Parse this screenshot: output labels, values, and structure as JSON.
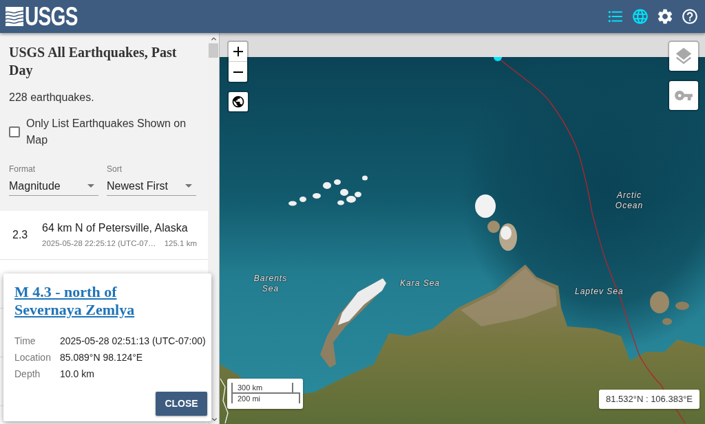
{
  "header": {
    "logo_text": "USGS",
    "nav_buttons": [
      {
        "kind": "list",
        "on": true
      },
      {
        "kind": "map",
        "on": true
      },
      {
        "kind": "settings",
        "on": false
      },
      {
        "kind": "help",
        "on": false
      }
    ]
  },
  "sidebar": {
    "title": "USGS All Earthquakes, Past Day",
    "count": "228 earthquakes.",
    "filter_checkbox": {
      "label": "Only List Earthquakes Shown on Map",
      "checked": false
    },
    "selects": [
      {
        "label": "Format",
        "value": "Magnitude"
      },
      {
        "label": "Sort",
        "value": "Newest First"
      }
    ],
    "earthquakes": [
      {
        "magnitude": "2.3",
        "place": "64 km N of Petersville, Alaska",
        "time": "2025-05-28 22:25:12 (UTC-07…",
        "depth": "125.1 km"
      }
    ]
  },
  "popup": {
    "title": "M 4.3 - north of Severnaya Zemlya",
    "details": [
      {
        "label": "Time",
        "value": "2025-05-28 02:51:13 (UTC-07:00)"
      },
      {
        "label": "Location",
        "value": "85.089°N 98.124°E"
      },
      {
        "label": "Depth",
        "value": "10.0 km"
      }
    ],
    "close_button": "CLOSE"
  },
  "map": {
    "labels": [
      "Arctic Ocean",
      "Barents Sea",
      "Kara Sea",
      "Laptev Sea"
    ],
    "scale": [
      "300 km",
      "200 mi"
    ],
    "coordinates": "81.532°N : 106.383°E"
  }
}
